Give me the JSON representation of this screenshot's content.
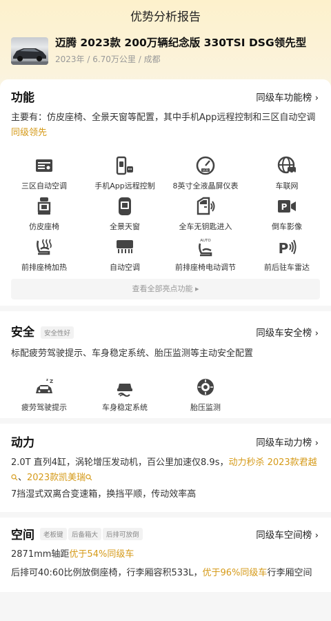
{
  "header": {
    "title": "优势分析报告"
  },
  "car": {
    "name": "迈腾 2023款 200万辆纪念版 330TSI DSG领先型",
    "meta": "2023年 / 6.70万公里 / 成都"
  },
  "function": {
    "title": "功能",
    "link": "同级车功能榜 ›",
    "desc_prefix": "主要有：仿皮座椅、全景天窗等配置，其中手机App远程控制和三区自动空调",
    "desc_highlight": "同级领先",
    "features": [
      {
        "label": "三区自动空调",
        "icon": "ac-panel-icon"
      },
      {
        "label": "手机App远程控制",
        "icon": "phone-car-icon"
      },
      {
        "label": "8英寸全液晶屏仪表",
        "icon": "lcd-gauge-icon"
      },
      {
        "label": "车联网",
        "icon": "globe-car-icon"
      },
      {
        "label": "仿皮座椅",
        "icon": "seat-icon"
      },
      {
        "label": "全景天窗",
        "icon": "sunroof-icon"
      },
      {
        "label": "全车无钥匙进入",
        "icon": "keyless-door-icon"
      },
      {
        "label": "倒车影像",
        "icon": "parking-camera-icon"
      },
      {
        "label": "前排座椅加热",
        "icon": "heated-seat-icon"
      },
      {
        "label": "自动空调",
        "icon": "auto-ac-icon"
      },
      {
        "label": "前排座椅电动调节",
        "icon": "power-seat-icon"
      },
      {
        "label": "前后驻车雷达",
        "icon": "parking-radar-icon"
      }
    ],
    "more": "查看全部亮点功能 ▸"
  },
  "safety": {
    "title": "安全",
    "tag": "安全性好",
    "link": "同级车安全榜 ›",
    "desc": "标配疲劳驾驶提示、车身稳定系统、胎压监测等主动安全配置",
    "features": [
      {
        "label": "疲劳驾驶提示",
        "icon": "fatigue-alert-icon"
      },
      {
        "label": "车身稳定系统",
        "icon": "stability-control-icon"
      },
      {
        "label": "胎压监测",
        "icon": "tire-pressure-icon"
      }
    ]
  },
  "power": {
    "title": "动力",
    "link": "同级车动力榜 ›",
    "line1_prefix": "2.0T 直列4缸，涡轮增压发动机，百公里加速仅8.9s，",
    "line1_highlight": "动力秒杀 2023款君越",
    "line1_sep": "、",
    "line1_highlight2": "2023款凯美瑞",
    "line2": "7挡湿式双离合变速箱，换挡平顺，传动效率高"
  },
  "space": {
    "title": "空间",
    "tags": [
      "老板键",
      "后备箱大",
      "后排可放倒"
    ],
    "link": "同级车空间榜 ›",
    "line1_prefix": "2871mm轴距",
    "line1_highlight": "优于54%同级车",
    "line2_prefix": "后排可40:60比例放倒座椅，行李厢容积533L，",
    "line2_highlight": "优于96%同级车",
    "line2_suffix": "行李厢空间"
  },
  "colors": {
    "highlight": "#d59a19",
    "icon": "#444444",
    "top_gradient": "#fdf1cc"
  }
}
